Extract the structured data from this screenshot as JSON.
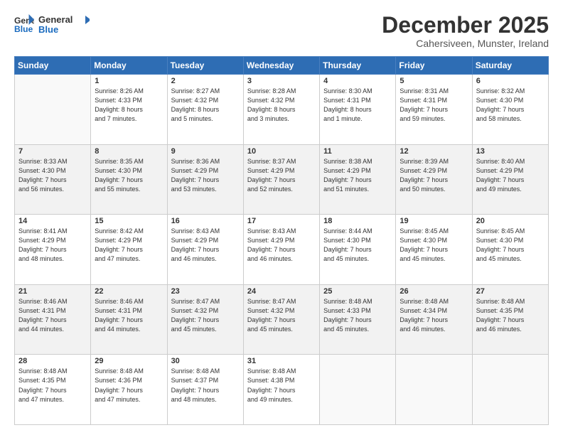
{
  "logo": {
    "line1": "General",
    "line2": "Blue"
  },
  "title": "December 2025",
  "subtitle": "Cahersiveen, Munster, Ireland",
  "days_of_week": [
    "Sunday",
    "Monday",
    "Tuesday",
    "Wednesday",
    "Thursday",
    "Friday",
    "Saturday"
  ],
  "weeks": [
    [
      {
        "num": "",
        "info": ""
      },
      {
        "num": "1",
        "info": "Sunrise: 8:26 AM\nSunset: 4:33 PM\nDaylight: 8 hours\nand 7 minutes."
      },
      {
        "num": "2",
        "info": "Sunrise: 8:27 AM\nSunset: 4:32 PM\nDaylight: 8 hours\nand 5 minutes."
      },
      {
        "num": "3",
        "info": "Sunrise: 8:28 AM\nSunset: 4:32 PM\nDaylight: 8 hours\nand 3 minutes."
      },
      {
        "num": "4",
        "info": "Sunrise: 8:30 AM\nSunset: 4:31 PM\nDaylight: 8 hours\nand 1 minute."
      },
      {
        "num": "5",
        "info": "Sunrise: 8:31 AM\nSunset: 4:31 PM\nDaylight: 7 hours\nand 59 minutes."
      },
      {
        "num": "6",
        "info": "Sunrise: 8:32 AM\nSunset: 4:30 PM\nDaylight: 7 hours\nand 58 minutes."
      }
    ],
    [
      {
        "num": "7",
        "info": "Sunrise: 8:33 AM\nSunset: 4:30 PM\nDaylight: 7 hours\nand 56 minutes."
      },
      {
        "num": "8",
        "info": "Sunrise: 8:35 AM\nSunset: 4:30 PM\nDaylight: 7 hours\nand 55 minutes."
      },
      {
        "num": "9",
        "info": "Sunrise: 8:36 AM\nSunset: 4:29 PM\nDaylight: 7 hours\nand 53 minutes."
      },
      {
        "num": "10",
        "info": "Sunrise: 8:37 AM\nSunset: 4:29 PM\nDaylight: 7 hours\nand 52 minutes."
      },
      {
        "num": "11",
        "info": "Sunrise: 8:38 AM\nSunset: 4:29 PM\nDaylight: 7 hours\nand 51 minutes."
      },
      {
        "num": "12",
        "info": "Sunrise: 8:39 AM\nSunset: 4:29 PM\nDaylight: 7 hours\nand 50 minutes."
      },
      {
        "num": "13",
        "info": "Sunrise: 8:40 AM\nSunset: 4:29 PM\nDaylight: 7 hours\nand 49 minutes."
      }
    ],
    [
      {
        "num": "14",
        "info": "Sunrise: 8:41 AM\nSunset: 4:29 PM\nDaylight: 7 hours\nand 48 minutes."
      },
      {
        "num": "15",
        "info": "Sunrise: 8:42 AM\nSunset: 4:29 PM\nDaylight: 7 hours\nand 47 minutes."
      },
      {
        "num": "16",
        "info": "Sunrise: 8:43 AM\nSunset: 4:29 PM\nDaylight: 7 hours\nand 46 minutes."
      },
      {
        "num": "17",
        "info": "Sunrise: 8:43 AM\nSunset: 4:29 PM\nDaylight: 7 hours\nand 46 minutes."
      },
      {
        "num": "18",
        "info": "Sunrise: 8:44 AM\nSunset: 4:30 PM\nDaylight: 7 hours\nand 45 minutes."
      },
      {
        "num": "19",
        "info": "Sunrise: 8:45 AM\nSunset: 4:30 PM\nDaylight: 7 hours\nand 45 minutes."
      },
      {
        "num": "20",
        "info": "Sunrise: 8:45 AM\nSunset: 4:30 PM\nDaylight: 7 hours\nand 45 minutes."
      }
    ],
    [
      {
        "num": "21",
        "info": "Sunrise: 8:46 AM\nSunset: 4:31 PM\nDaylight: 7 hours\nand 44 minutes."
      },
      {
        "num": "22",
        "info": "Sunrise: 8:46 AM\nSunset: 4:31 PM\nDaylight: 7 hours\nand 44 minutes."
      },
      {
        "num": "23",
        "info": "Sunrise: 8:47 AM\nSunset: 4:32 PM\nDaylight: 7 hours\nand 45 minutes."
      },
      {
        "num": "24",
        "info": "Sunrise: 8:47 AM\nSunset: 4:32 PM\nDaylight: 7 hours\nand 45 minutes."
      },
      {
        "num": "25",
        "info": "Sunrise: 8:48 AM\nSunset: 4:33 PM\nDaylight: 7 hours\nand 45 minutes."
      },
      {
        "num": "26",
        "info": "Sunrise: 8:48 AM\nSunset: 4:34 PM\nDaylight: 7 hours\nand 46 minutes."
      },
      {
        "num": "27",
        "info": "Sunrise: 8:48 AM\nSunset: 4:35 PM\nDaylight: 7 hours\nand 46 minutes."
      }
    ],
    [
      {
        "num": "28",
        "info": "Sunrise: 8:48 AM\nSunset: 4:35 PM\nDaylight: 7 hours\nand 47 minutes."
      },
      {
        "num": "29",
        "info": "Sunrise: 8:48 AM\nSunset: 4:36 PM\nDaylight: 7 hours\nand 47 minutes."
      },
      {
        "num": "30",
        "info": "Sunrise: 8:48 AM\nSunset: 4:37 PM\nDaylight: 7 hours\nand 48 minutes."
      },
      {
        "num": "31",
        "info": "Sunrise: 8:48 AM\nSunset: 4:38 PM\nDaylight: 7 hours\nand 49 minutes."
      },
      {
        "num": "",
        "info": ""
      },
      {
        "num": "",
        "info": ""
      },
      {
        "num": "",
        "info": ""
      }
    ]
  ]
}
